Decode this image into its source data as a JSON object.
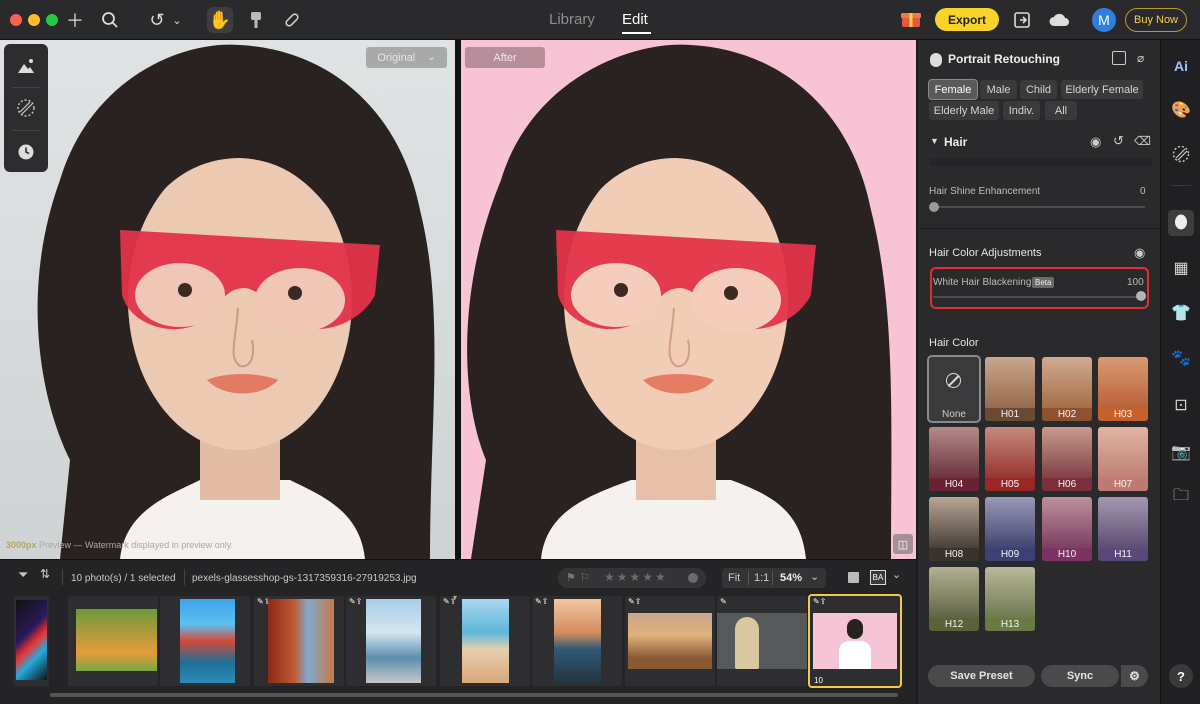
{
  "topbar": {
    "tabs": [
      "Library",
      "Edit"
    ],
    "active_tab": "Edit",
    "export_label": "Export",
    "avatar_letter": "M",
    "buy_label": "Buy Now"
  },
  "canvas": {
    "original_chip": "Original",
    "after_chip": "After",
    "watermark_strong": "3000px",
    "watermark_rest": " Preview — Watermark displayed in preview only."
  },
  "filmstrip": {
    "count_text": "10 photo(s) / 1 selected",
    "filename": "pexels-glassesshop-gs-1317359316-27919253.jpg",
    "fit_label": "Fit",
    "ratio_label": "1:1",
    "zoom_label": "54%",
    "selected_badge": "10"
  },
  "panel": {
    "title": "Portrait Retouching",
    "filters": [
      "Female",
      "Male",
      "Child",
      "Elderly Female",
      "Elderly Male",
      "Indiv.",
      "All"
    ],
    "active_filter": "Female",
    "hair_section": "Hair",
    "shine_label": "Hair Shine Enhancement",
    "shine_value": "0",
    "color_adj_title": "Hair Color Adjustments",
    "white_hair_label": "White Hair Blackening",
    "beta_badge": "Beta",
    "white_hair_value": "100",
    "hair_color_title": "Hair Color",
    "swatches": [
      "None",
      "H01",
      "H02",
      "H03",
      "H04",
      "H05",
      "H06",
      "H07",
      "H08",
      "H09",
      "H10",
      "H11",
      "H12",
      "H13"
    ],
    "save_preset": "Save Preset",
    "sync": "Sync"
  },
  "colors": {
    "accent": "#f8d32a",
    "highlight": "#e0302e",
    "after_bg": "#f7c3d5"
  }
}
